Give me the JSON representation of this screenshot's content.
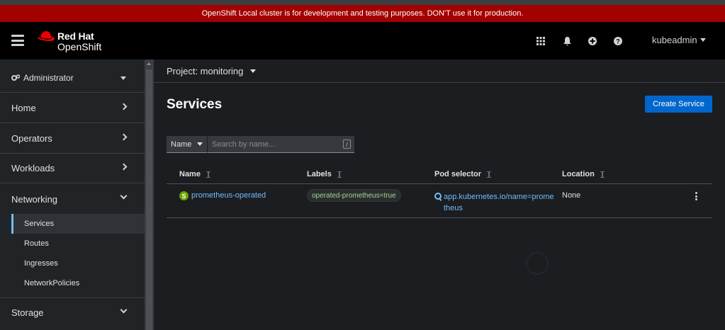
{
  "banner": {
    "text": "OpenShift Local cluster is for development and testing purposes. DON'T use it for production."
  },
  "masthead": {
    "brand_line1": "Red Hat",
    "brand_line2": "OpenShift",
    "user": "kubeadmin",
    "icons": [
      "apps-grid-icon",
      "bell-icon",
      "plus-circle-icon",
      "help-icon"
    ]
  },
  "sidebar": {
    "perspective": "Administrator",
    "sections": [
      {
        "label": "Home"
      },
      {
        "label": "Operators"
      },
      {
        "label": "Workloads"
      },
      {
        "label": "Networking"
      },
      {
        "label": "Storage"
      }
    ],
    "networking_items": [
      "Services",
      "Routes",
      "Ingresses",
      "NetworkPolicies"
    ],
    "active_item": "Services"
  },
  "project": {
    "label": "Project: monitoring"
  },
  "page": {
    "title": "Services",
    "create_button": "Create Service"
  },
  "filter": {
    "type": "Name",
    "placeholder": "Search by name...",
    "shortcut": "/"
  },
  "table": {
    "columns": [
      "Name",
      "Labels",
      "Pod selector",
      "Location"
    ],
    "rows": [
      {
        "badge": "S",
        "name": "prometheus-operated",
        "label": "operated-prometheus=true",
        "selector_line1": "app.kubernetes.io/name=prome",
        "selector_line2": "theus",
        "location": "None"
      }
    ]
  },
  "colors": {
    "banner": "#a30000",
    "primary_button": "#0066cc",
    "link": "#73bcf7",
    "service_badge": "#6ca100",
    "label_text": "#a2d38a"
  }
}
